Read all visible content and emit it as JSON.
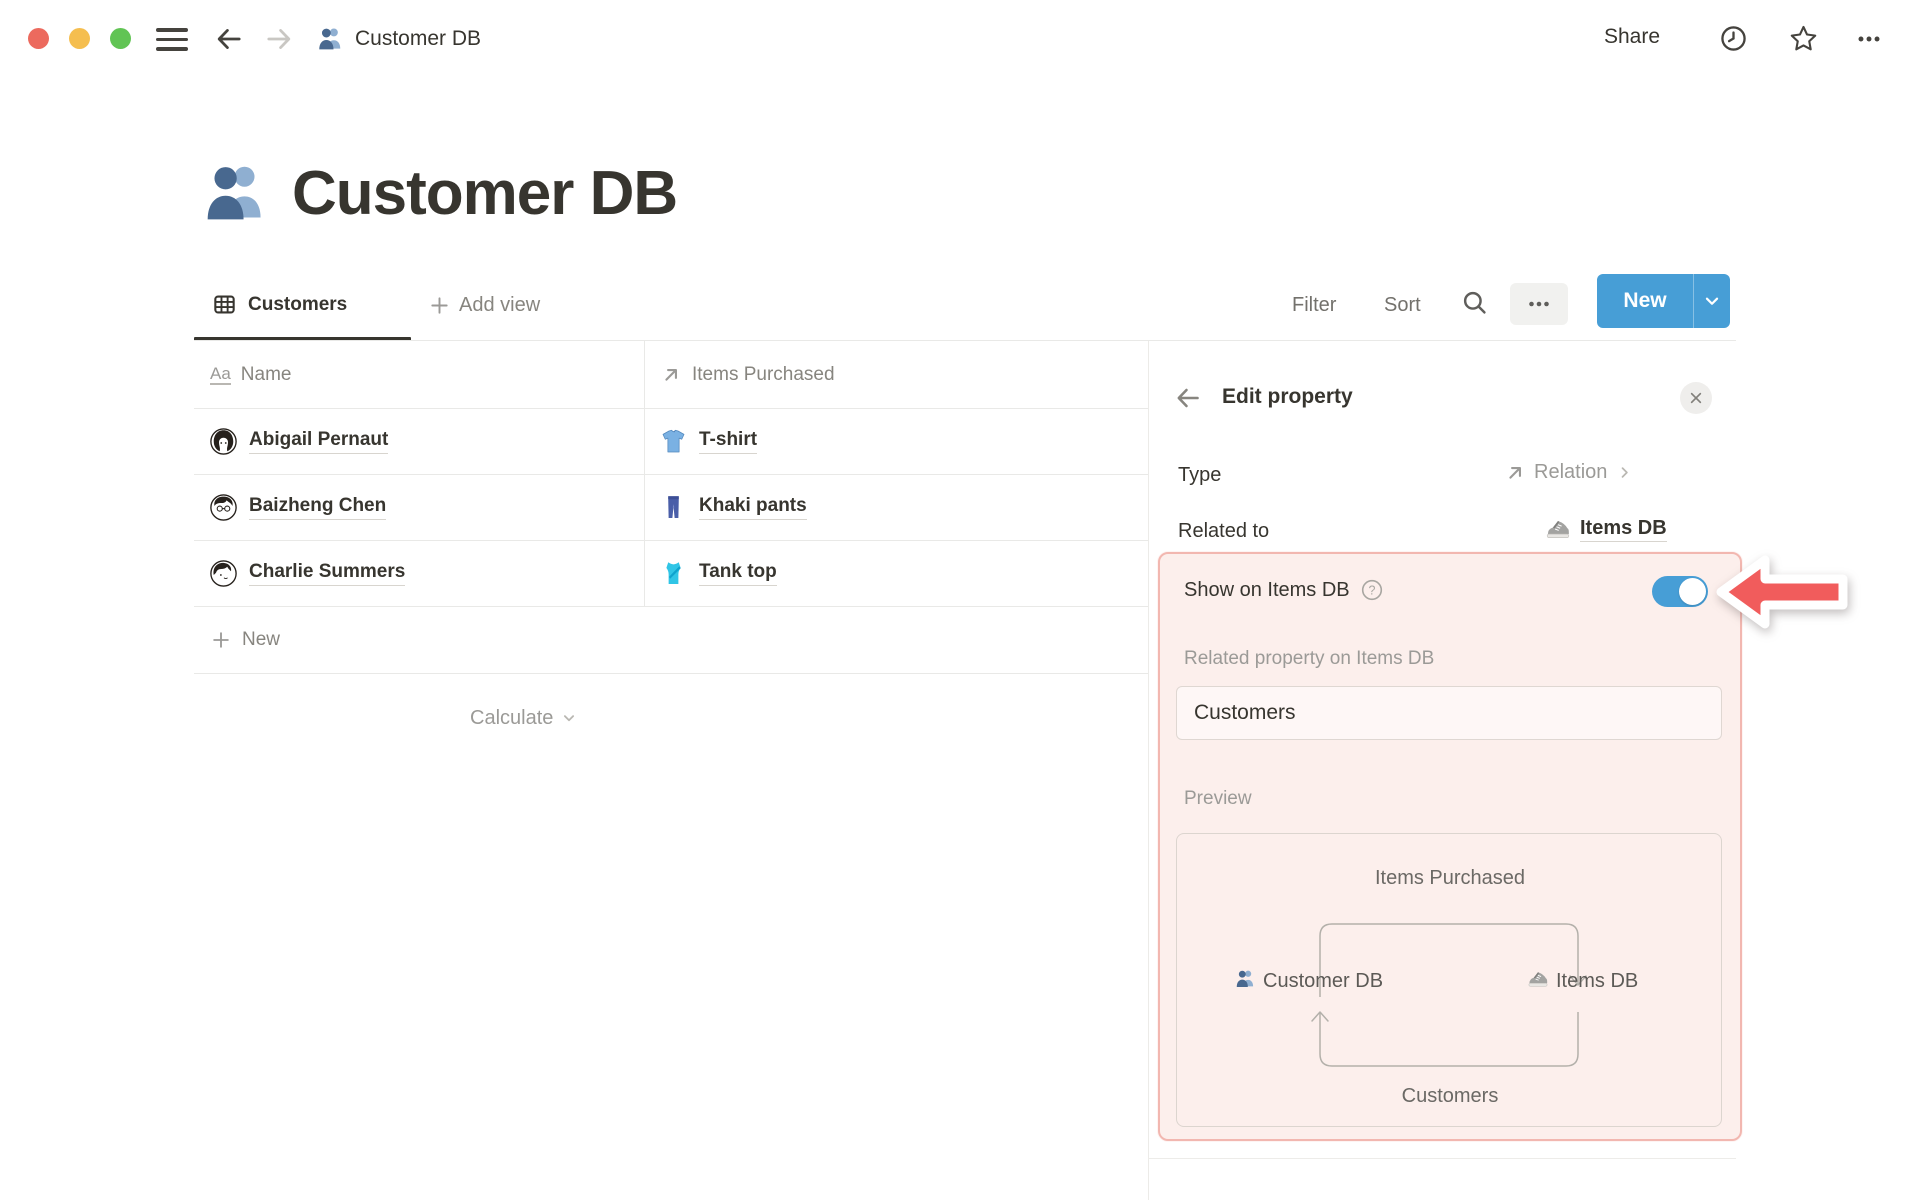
{
  "titlebar": {
    "doc_title": "Customer DB",
    "share": "Share"
  },
  "page": {
    "title": "Customer DB",
    "icon": "people-emoji"
  },
  "views": {
    "active_tab": "Customers",
    "active_tab_icon": "table-view-icon",
    "add_view": "Add view"
  },
  "toolbar": {
    "filter": "Filter",
    "sort": "Sort",
    "new": "New",
    "icons": [
      "search-icon",
      "more-ellipsis-icon",
      "new-dropdown-chevron-icon"
    ]
  },
  "table": {
    "columns": [
      {
        "label": "Name",
        "icon": "text-property-icon"
      },
      {
        "label": "Items Purchased",
        "icon": "relation-arrow-icon"
      }
    ],
    "rows": [
      {
        "name": "Abigail Pernaut",
        "avatar": "abigail-avatar",
        "item": "T-shirt",
        "item_icon": "tshirt-emoji"
      },
      {
        "name": "Baizheng Chen",
        "avatar": "baizheng-avatar",
        "item": "Khaki pants",
        "item_icon": "jeans-emoji"
      },
      {
        "name": "Charlie Summers",
        "avatar": "charlie-avatar",
        "item": "Tank top",
        "item_icon": "tanktop-emoji"
      }
    ],
    "new_row_label": "New",
    "calculate_label": "Calculate"
  },
  "panel": {
    "title": "Edit property",
    "rows": {
      "type": {
        "label": "Type",
        "value": "Relation",
        "value_icon": "relation-arrow-icon"
      },
      "related_to": {
        "label": "Related to",
        "value": "Items DB",
        "value_icon": "sneaker-emoji"
      },
      "show_on": {
        "label": "Show on Items DB",
        "toggle_state": "on",
        "help_icon": "help-icon"
      }
    },
    "related_property": {
      "label": "Related property on Items DB",
      "value": "Customers"
    },
    "preview": {
      "label": "Preview",
      "top_property": "Items Purchased",
      "left_db": "Customer DB",
      "left_db_icon": "people-emoji",
      "right_db": "Items DB",
      "right_db_icon": "sneaker-emoji",
      "bottom_property": "Customers"
    },
    "annotation": "red-arrow-pointing-at-toggle"
  },
  "colors": {
    "accent_blue": "#479ED6",
    "highlight_bg": "#FCEFEC",
    "highlight_border": "#F2B7B0",
    "arrow_red": "#F15C5C",
    "text_dark": "#37352F",
    "text_gray": "#87857F",
    "border_light": "#E9E9E7",
    "traffic_red": "#EC6A5E",
    "traffic_yellow": "#F5BE4F",
    "traffic_green": "#61C454"
  }
}
